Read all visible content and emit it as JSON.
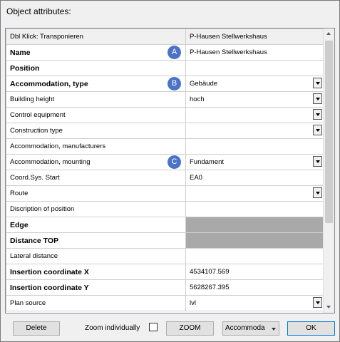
{
  "window": {
    "title": "Object attributes:"
  },
  "header": {
    "label": "Dbl Klick: Transponieren",
    "value": "P-Hausen Stellwerkshaus"
  },
  "rows": [
    {
      "label": "Name",
      "value": "P-Hausen Stellwerkshaus",
      "bold": true,
      "marker": "A",
      "dropdown": false,
      "gray": false
    },
    {
      "label": "Position",
      "value": "",
      "bold": true,
      "marker": "",
      "dropdown": false,
      "gray": false
    },
    {
      "label": "Accommodation, type",
      "value": "Gebäude",
      "bold": true,
      "marker": "B",
      "dropdown": true,
      "gray": false
    },
    {
      "label": "Building height",
      "value": "hoch",
      "bold": false,
      "marker": "",
      "dropdown": true,
      "gray": false
    },
    {
      "label": "Control equipment",
      "value": "",
      "bold": false,
      "marker": "",
      "dropdown": true,
      "gray": false
    },
    {
      "label": "Construction type",
      "value": "",
      "bold": false,
      "marker": "",
      "dropdown": true,
      "gray": false
    },
    {
      "label": "Accommodation, manufacturers",
      "value": "",
      "bold": false,
      "marker": "",
      "dropdown": false,
      "gray": false
    },
    {
      "label": "Accommodation, mounting",
      "value": "Fundament",
      "bold": false,
      "marker": "C",
      "dropdown": true,
      "gray": false
    },
    {
      "label": "Coord.Sys. Start",
      "value": "EA0",
      "bold": false,
      "marker": "",
      "dropdown": false,
      "gray": false
    },
    {
      "label": "Route",
      "value": "",
      "bold": false,
      "marker": "",
      "dropdown": true,
      "gray": false
    },
    {
      "label": "Discription of position",
      "value": "",
      "bold": false,
      "marker": "",
      "dropdown": false,
      "gray": false
    },
    {
      "label": "Edge",
      "value": "",
      "bold": true,
      "marker": "",
      "dropdown": false,
      "gray": true
    },
    {
      "label": "Distance TOP",
      "value": "",
      "bold": true,
      "marker": "",
      "dropdown": false,
      "gray": true
    },
    {
      "label": "Lateral distance",
      "value": "",
      "bold": false,
      "marker": "",
      "dropdown": false,
      "gray": false
    },
    {
      "label": "Insertion coordinate X",
      "value": "4534107.569",
      "bold": true,
      "marker": "",
      "dropdown": false,
      "gray": false
    },
    {
      "label": "Insertion coordinate Y",
      "value": "5628267.395",
      "bold": true,
      "marker": "",
      "dropdown": false,
      "gray": false
    },
    {
      "label": "Plan source",
      "value": "lvl",
      "bold": false,
      "marker": "",
      "dropdown": true,
      "gray": false
    }
  ],
  "footer": {
    "delete_label": "Delete",
    "zoom_individually_label": "Zoom individually",
    "zoom_individually_checked": false,
    "zoom_label": "ZOOM",
    "combo_value": "Accommoda",
    "ok_label": "OK"
  },
  "colors": {
    "marker": "#4a73c8",
    "gray_cell": "#a9a9a9",
    "ok_border": "#0078d7"
  }
}
